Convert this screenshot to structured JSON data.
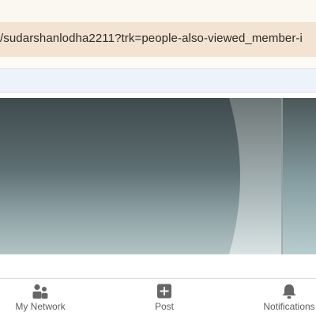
{
  "browser": {
    "url_fragment": "/sudarshanlodha2211?trk=people-also-viewed_member-i"
  },
  "bottom_nav": {
    "items": [
      {
        "label": "My Network",
        "icon": "people-icon"
      },
      {
        "label": "Post",
        "icon": "plus-square-icon"
      },
      {
        "label": "Notifications",
        "icon": "bell-icon"
      }
    ]
  },
  "colors": {
    "url_bar_bg": "#f2e3d2",
    "nav_icon": "#666666"
  }
}
